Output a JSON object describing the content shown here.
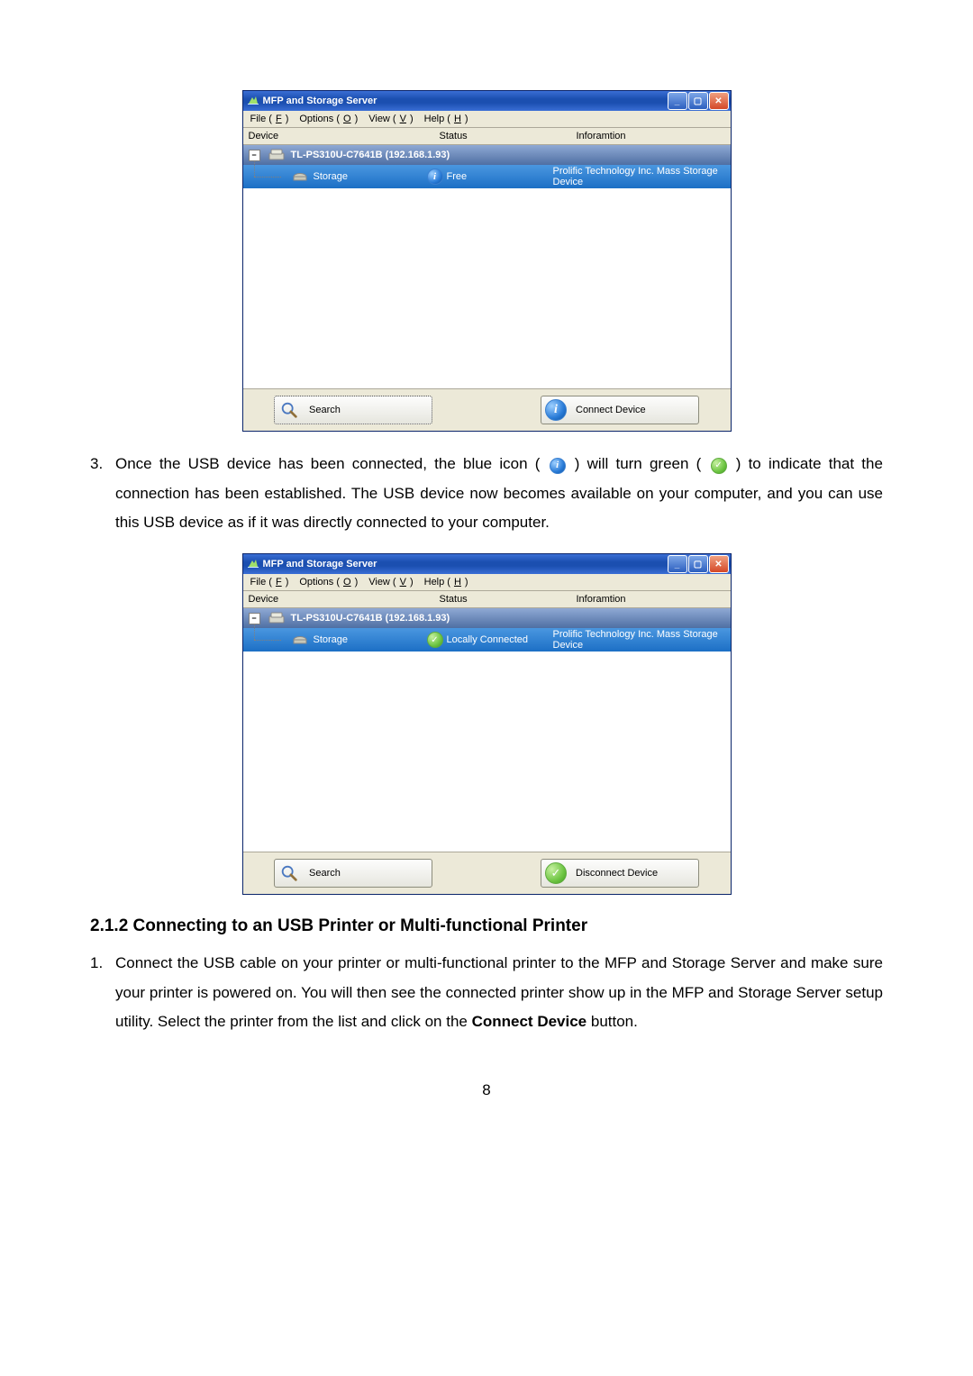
{
  "window": {
    "title": "MFP and Storage Server",
    "menu": {
      "file": "File (F)",
      "options": "Options (O)",
      "view": "View (V)",
      "help": "Help (H)"
    },
    "columns": {
      "device": "Device",
      "status": "Status",
      "info": "Inforamtion"
    },
    "server_row": "TL-PS310U-C7641B  (192.168.1.93)",
    "tree_symbol": "−"
  },
  "screenshot1": {
    "device_name": "Storage",
    "status": "Free",
    "info": "Prolific Technology Inc. Mass Storage Device",
    "btn_search": "Search",
    "btn_action": "Connect Device"
  },
  "screenshot2": {
    "device_name": "Storage",
    "status": "Locally Connected",
    "info": "Prolific Technology Inc. Mass Storage Device",
    "btn_search": "Search",
    "btn_action": "Disconnect Device"
  },
  "text": {
    "item3_marker": "3.",
    "item3_a": "Once the USB device has been connected, the blue icon (",
    "item3_b": ") will turn green (",
    "item3_c": ") to indicate that the connection has been established. The USB device now becomes available on your computer, and you can use this USB device as if it was directly connected to your computer.",
    "section_heading": "2.1.2  Connecting to an USB Printer or Multi-functional Printer",
    "item1_marker": "1.",
    "item1_a": "Connect the USB cable on your printer or multi-functional printer to the MFP and Storage Server and make sure your printer is powered on. You will then see the connected printer show up in the MFP and Storage Server setup utility. Select the printer from the list and click on the ",
    "item1_bold": "Connect Device",
    "item1_b": " button.",
    "page_number": "8"
  }
}
